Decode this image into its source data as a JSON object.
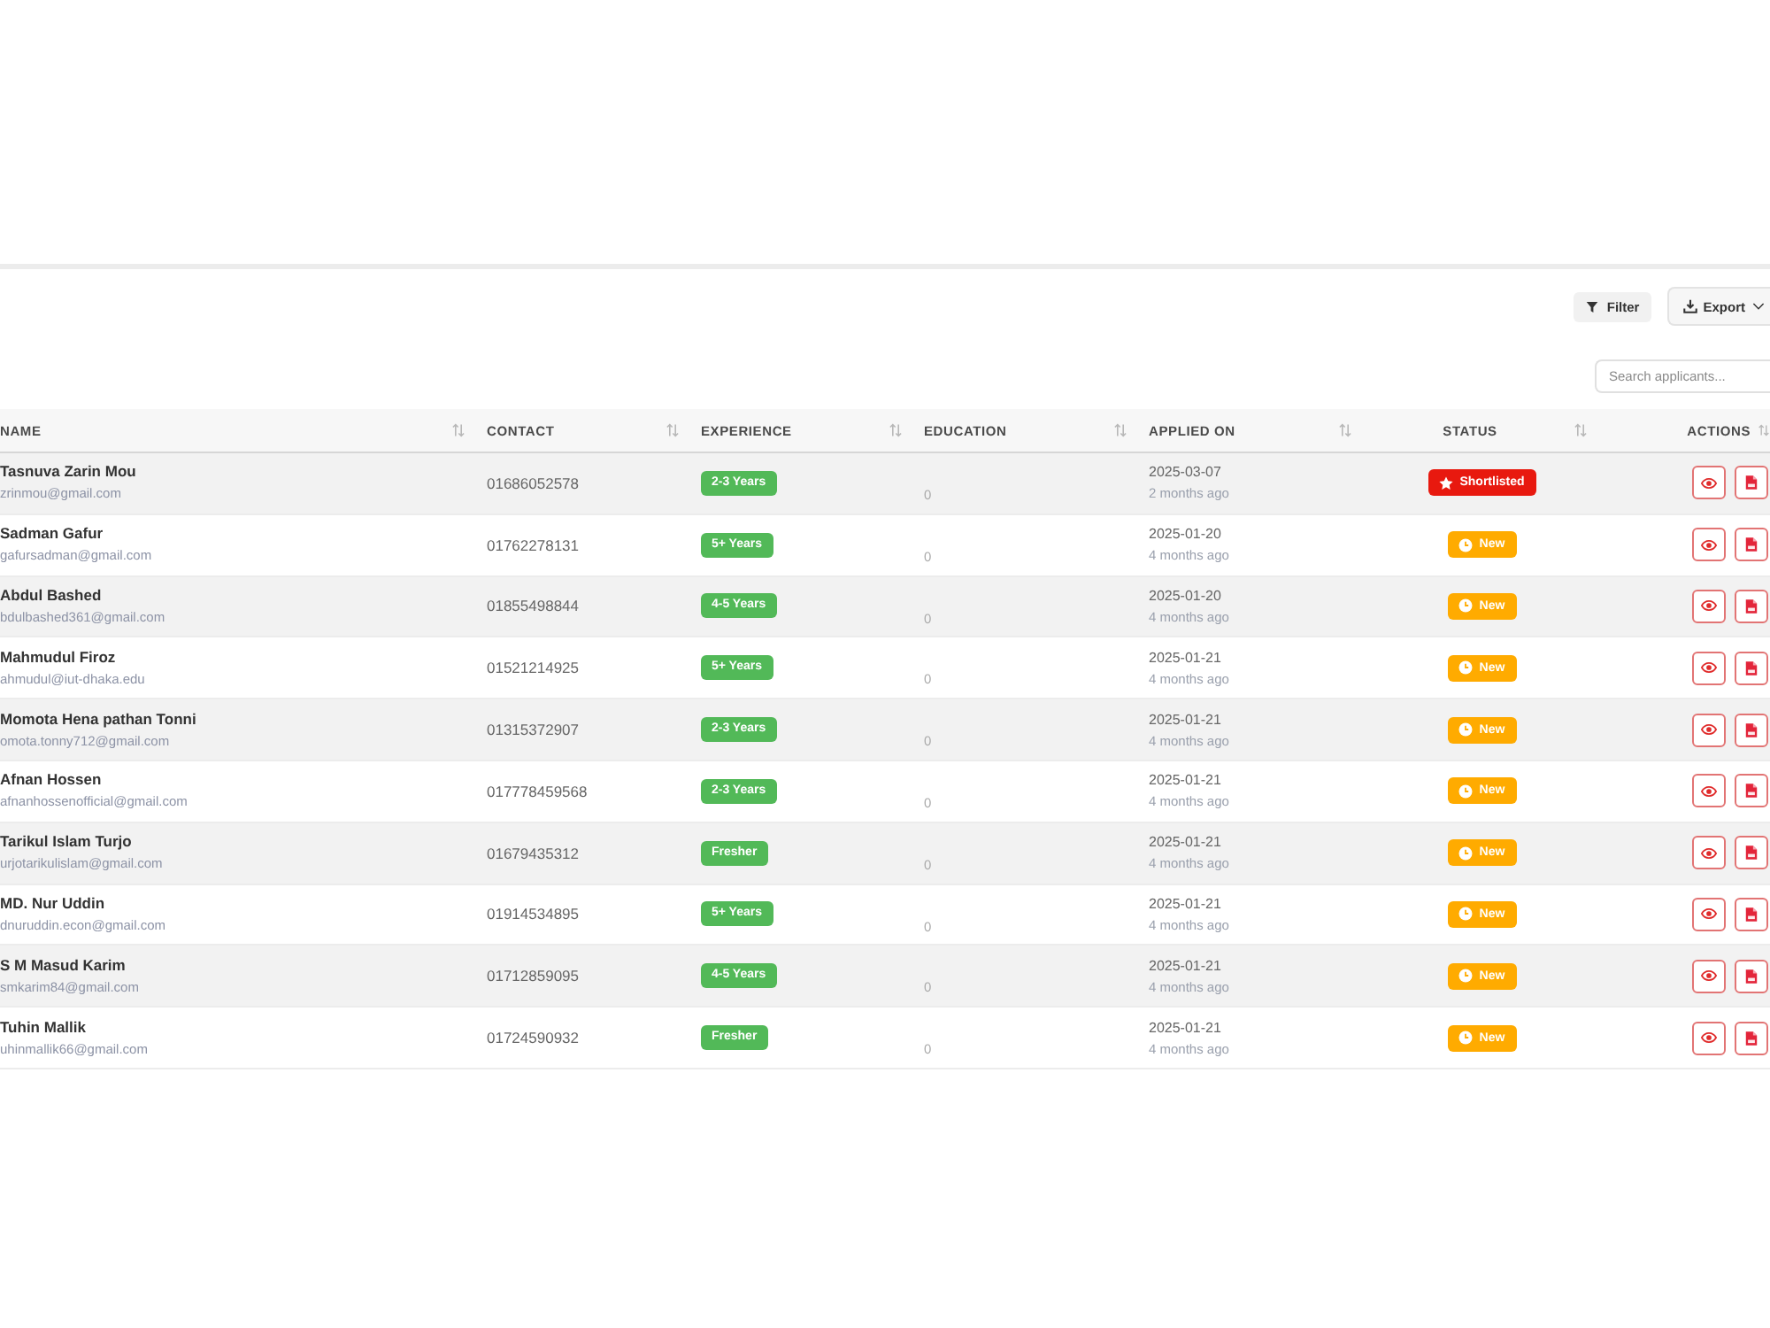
{
  "toolbar": {
    "filter_button": {
      "label": "Filter"
    },
    "export_button": {
      "label": "Export"
    }
  },
  "search": {
    "placeholder": "Search applicants..."
  },
  "table": {
    "columns": [
      "NAME",
      "CONTACT",
      "EXPERIENCE",
      "EDUCATION",
      "APPLIED ON",
      "STATUS",
      "ACTIONS"
    ],
    "rows": [
      {
        "name": "Tasnuva Zarin Mou",
        "email": "zrinmou@gmail.com",
        "contact": "01686052578",
        "experience": "2-3 Years",
        "education": "0",
        "applied_on": "2025-03-07",
        "applied_ago": "2 months ago",
        "status": {
          "label": "Shortlisted",
          "kind": "shortlisted",
          "color": "#e8190f"
        }
      },
      {
        "name": "Sadman Gafur",
        "email": "gafursadman@gmail.com",
        "contact": "01762278131",
        "experience": "5+ Years",
        "education": "0",
        "applied_on": "2025-01-20",
        "applied_ago": "4 months ago",
        "status": {
          "label": "New",
          "kind": "new",
          "color": "#ffab00"
        }
      },
      {
        "name": "Abdul Bashed",
        "email": "bdulbashed361@gmail.com",
        "contact": "01855498844",
        "experience": "4-5 Years",
        "education": "0",
        "applied_on": "2025-01-20",
        "applied_ago": "4 months ago",
        "status": {
          "label": "New",
          "kind": "new",
          "color": "#ffab00"
        }
      },
      {
        "name": "Mahmudul Firoz",
        "email": "ahmudul@iut-dhaka.edu",
        "contact": "01521214925",
        "experience": "5+ Years",
        "education": "0",
        "applied_on": "2025-01-21",
        "applied_ago": "4 months ago",
        "status": {
          "label": "New",
          "kind": "new",
          "color": "#ffab00"
        }
      },
      {
        "name": "Momota Hena pathan Tonni",
        "email": "omota.tonny712@gmail.com",
        "contact": "01315372907",
        "experience": "2-3 Years",
        "education": "0",
        "applied_on": "2025-01-21",
        "applied_ago": "4 months ago",
        "status": {
          "label": "New",
          "kind": "new",
          "color": "#ffab00"
        }
      },
      {
        "name": "Afnan Hossen",
        "email": "afnanhossenofficial@gmail.com",
        "contact": "017778459568",
        "experience": "2-3 Years",
        "education": "0",
        "applied_on": "2025-01-21",
        "applied_ago": "4 months ago",
        "status": {
          "label": "New",
          "kind": "new",
          "color": "#ffab00"
        }
      },
      {
        "name": "Tarikul Islam Turjo",
        "email": "urjotarikulislam@gmail.com",
        "contact": "01679435312",
        "experience": "Fresher",
        "education": "0",
        "applied_on": "2025-01-21",
        "applied_ago": "4 months ago",
        "status": {
          "label": "New",
          "kind": "new",
          "color": "#ffab00"
        }
      },
      {
        "name": "MD. Nur Uddin",
        "email": "dnuruddin.econ@gmail.com",
        "contact": "01914534895",
        "experience": "5+ Years",
        "education": "0",
        "applied_on": "2025-01-21",
        "applied_ago": "4 months ago",
        "status": {
          "label": "New",
          "kind": "new",
          "color": "#ffab00"
        }
      },
      {
        "name": "S M Masud Karim",
        "email": "smkarim84@gmail.com",
        "contact": "01712859095",
        "experience": "4-5 Years",
        "education": "0",
        "applied_on": "2025-01-21",
        "applied_ago": "4 months ago",
        "status": {
          "label": "New",
          "kind": "new",
          "color": "#ffab00"
        }
      },
      {
        "name": "Tuhin Mallik",
        "email": "uhinmallik66@gmail.com",
        "contact": "01724590932",
        "experience": "Fresher",
        "education": "0",
        "applied_on": "2025-01-21",
        "applied_ago": "4 months ago",
        "status": {
          "label": "New",
          "kind": "new",
          "color": "#ffab00"
        }
      }
    ]
  }
}
